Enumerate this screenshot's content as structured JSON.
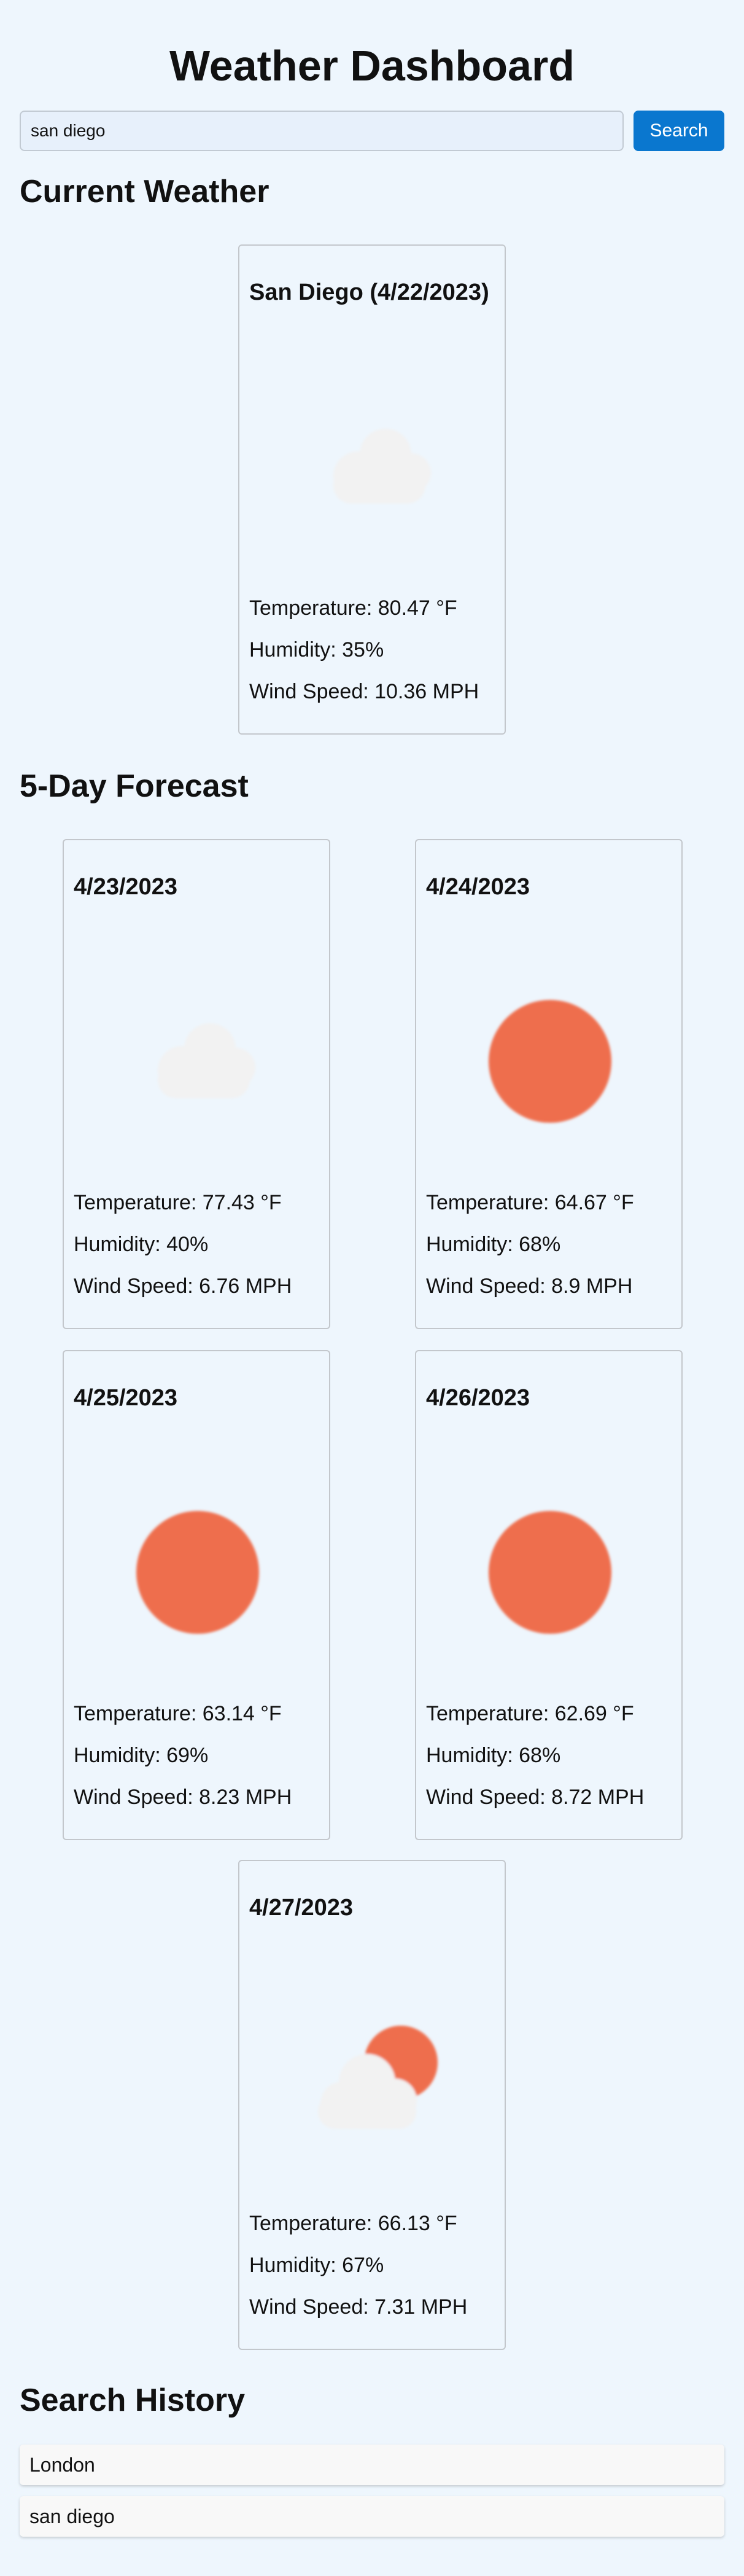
{
  "header": {
    "title": "Weather Dashboard"
  },
  "search": {
    "value": "san diego",
    "button_label": "Search"
  },
  "current": {
    "heading": "Current Weather",
    "card": {
      "title": "San Diego (4/22/2023)",
      "icon": "cloud-icon",
      "temperature": "Temperature: 80.47 °F",
      "humidity": "Humidity: 35%",
      "wind": "Wind Speed: 10.36 MPH"
    }
  },
  "forecast": {
    "heading": "5-Day Forecast",
    "days": [
      {
        "date": "4/23/2023",
        "icon": "cloud-icon",
        "temperature": "Temperature: 77.43 °F",
        "humidity": "Humidity: 40%",
        "wind": "Wind Speed: 6.76 MPH"
      },
      {
        "date": "4/24/2023",
        "icon": "sun-icon",
        "temperature": "Temperature: 64.67 °F",
        "humidity": "Humidity: 68%",
        "wind": "Wind Speed: 8.9 MPH"
      },
      {
        "date": "4/25/2023",
        "icon": "sun-icon",
        "temperature": "Temperature: 63.14 °F",
        "humidity": "Humidity: 69%",
        "wind": "Wind Speed: 8.23 MPH"
      },
      {
        "date": "4/26/2023",
        "icon": "sun-icon",
        "temperature": "Temperature: 62.69 °F",
        "humidity": "Humidity: 68%",
        "wind": "Wind Speed: 8.72 MPH"
      },
      {
        "date": "4/27/2023",
        "icon": "sun-behind-cloud-icon",
        "temperature": "Temperature: 66.13 °F",
        "humidity": "Humidity: 67%",
        "wind": "Wind Speed: 7.31 MPH"
      }
    ]
  },
  "history": {
    "heading": "Search History",
    "items": [
      "London",
      "san diego"
    ]
  },
  "colors": {
    "background": "#eef6fd",
    "accent": "#0a77cf",
    "sun": "#ee6e4e",
    "cloud": "#f2f2f2"
  }
}
